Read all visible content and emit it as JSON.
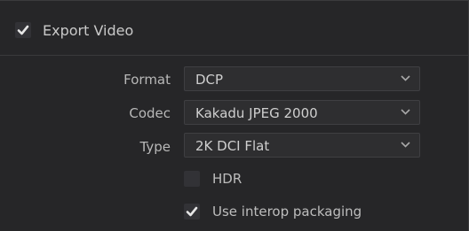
{
  "section": {
    "title": "Export Video",
    "enabled": true
  },
  "fields": {
    "format": {
      "label": "Format",
      "value": "DCP"
    },
    "codec": {
      "label": "Codec",
      "value": "Kakadu JPEG 2000"
    },
    "type": {
      "label": "Type",
      "value": "2K DCI Flat"
    }
  },
  "options": {
    "hdr": {
      "label": "HDR",
      "checked": false
    },
    "interop": {
      "label": "Use interop packaging",
      "checked": true
    }
  },
  "icons": {
    "check": "check-icon",
    "chevron": "chevron-down-icon"
  },
  "colors": {
    "panel_bg": "#262628",
    "control_bg": "#2e2e30",
    "text": "#bdbdbd"
  }
}
